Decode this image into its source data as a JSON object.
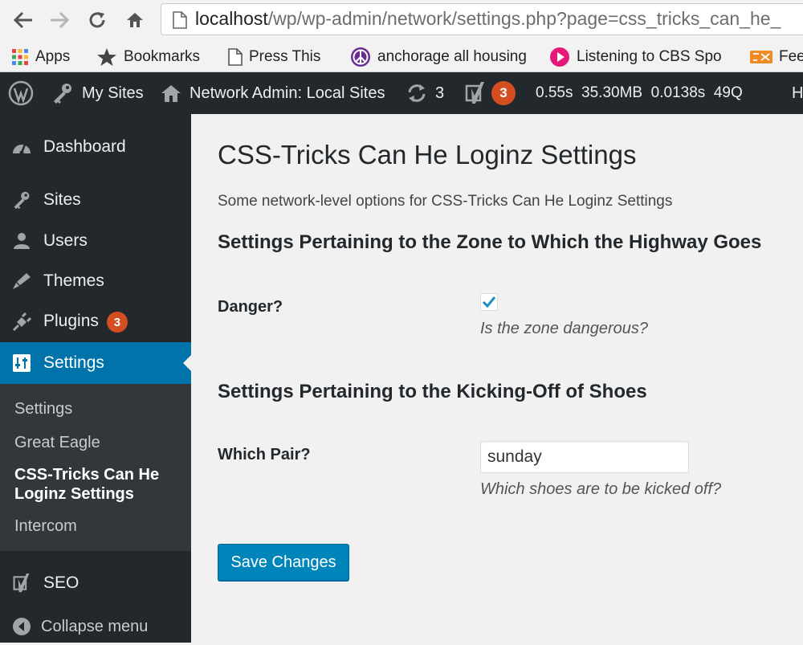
{
  "browser": {
    "url_host": "localhost",
    "url_path": "/wp/wp-admin/network/settings.php?page=css_tricks_can_he_",
    "bookmarks": [
      {
        "label": "Apps",
        "icon": "apps-grid-icon"
      },
      {
        "label": "Bookmarks",
        "icon": "star-icon"
      },
      {
        "label": "Press This",
        "icon": "page-icon"
      },
      {
        "label": "anchorage all housing",
        "icon": "peace-icon"
      },
      {
        "label": "Listening to CBS Spo",
        "icon": "play-icon"
      },
      {
        "label": "Fee",
        "icon": "feed-icon"
      }
    ]
  },
  "adminbar": {
    "my_sites": "My Sites",
    "network_admin": "Network Admin: Local Sites",
    "updates_count": "3",
    "yoast_count": "3",
    "perf_time": "0.55s",
    "perf_memory": "35.30MB",
    "perf_query_time": "0.0138s",
    "perf_queries": "49Q",
    "howdy_partial": "H"
  },
  "sidebar": {
    "items": [
      {
        "label": "Dashboard",
        "icon": "dashboard-icon"
      },
      {
        "label": "Sites",
        "icon": "key-icon"
      },
      {
        "label": "Users",
        "icon": "users-icon"
      },
      {
        "label": "Themes",
        "icon": "themes-icon"
      },
      {
        "label": "Plugins",
        "icon": "plugins-icon",
        "badge": "3"
      },
      {
        "label": "Settings",
        "icon": "settings-icon",
        "current": true
      }
    ],
    "submenu": [
      {
        "label": "Settings"
      },
      {
        "label": "Great Eagle"
      },
      {
        "label": "CSS-Tricks Can He Loginz Settings",
        "current": true
      },
      {
        "label": "Intercom"
      }
    ],
    "seo": "SEO",
    "collapse": "Collapse menu"
  },
  "main": {
    "title": "CSS-Tricks Can He Loginz Settings",
    "description": "Some network-level options for CSS-Tricks Can He Loginz Settings",
    "section1": {
      "heading": "Settings Pertaining to the Zone to Which the Highway Goes",
      "field_label": "Danger?",
      "checked": true,
      "field_desc": "Is the zone dangerous?"
    },
    "section2": {
      "heading": "Settings Pertaining to the Kicking-Off of Shoes",
      "field_label": "Which Pair?",
      "value": "sunday",
      "field_desc": "Which shoes are to be kicked off?"
    },
    "save_label": "Save Changes"
  },
  "colors": {
    "adminbar_bg": "#23282d",
    "accent": "#0073aa",
    "button": "#0085ba",
    "badge": "#d54e21"
  }
}
